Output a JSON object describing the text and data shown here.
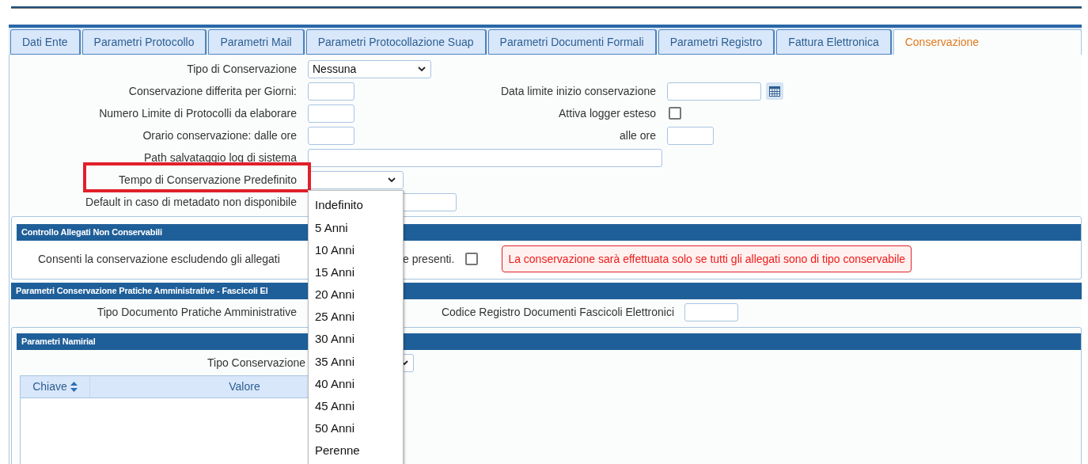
{
  "tabs": [
    {
      "label": "Dati Ente",
      "selected": false
    },
    {
      "label": "Parametri Protocollo",
      "selected": false
    },
    {
      "label": "Parametri Mail",
      "selected": false
    },
    {
      "label": "Parametri Protocollazione Suap",
      "selected": false
    },
    {
      "label": "Parametri Documenti Formali",
      "selected": false
    },
    {
      "label": "Parametri Registro",
      "selected": false
    },
    {
      "label": "Fattura Elettronica",
      "selected": false
    },
    {
      "label": "Conservazione",
      "selected": true
    }
  ],
  "settings": [
    {
      "label": "Tipo di Conservazione",
      "kind": "select",
      "value": "Nessuna"
    },
    {
      "label": "Conservazione differita per Giorni:",
      "kind": "short_input",
      "right": {
        "label": "Data limite inizio conservazione",
        "kind": "date"
      }
    },
    {
      "label": "Numero Limite di Protocolli da elaborare",
      "kind": "short_input",
      "right": {
        "label": "Attiva logger esteso",
        "kind": "checkbox",
        "checked": false
      }
    },
    {
      "label": "Orario conservazione: dalle ore",
      "kind": "short_input",
      "right": {
        "label": "alle ore",
        "kind": "short_input"
      }
    },
    {
      "label": "Path salvataggio log di sistema",
      "kind": "long_input"
    },
    {
      "label": "Tempo di Conservazione Predefinito",
      "kind": "open_select",
      "highlighted": true,
      "options": [
        "Indefinito",
        "5 Anni",
        "10 Anni",
        "15 Anni",
        "20 Anni",
        "25 Anni",
        "30 Anni",
        "35 Anni",
        "40 Anni",
        "45 Anni",
        "50 Anni",
        "Perenne"
      ]
    },
    {
      "label": "Default in caso di metadato non disponibile",
      "kind": "medium_input"
    }
  ],
  "attachment_check": {
    "title": "Controllo Allegati Non Conservabili",
    "option_text_before": "Consenti la conservazione escludendo gli allegati",
    "option_text_after": "e presenti.",
    "checked": false,
    "notice": "La conservazione sarà effettuata solo se tutti gli allegati sono di tipo conservabile"
  },
  "dossier_section": {
    "title": "Parametri Conservazione Pratiche Amministrative - Fascicoli El",
    "left_label": "Tipo Documento Pratiche Amministrative",
    "right_label": "Codice Registro Documenti Fascicoli Elettronici"
  },
  "namirial": {
    "title": "Parametri Namirial",
    "field_label": "Tipo Conservazione",
    "table": {
      "columns": [
        {
          "label": "Chiave",
          "sortable": true
        },
        {
          "label": "Valore",
          "sortable": false
        }
      ]
    }
  }
}
